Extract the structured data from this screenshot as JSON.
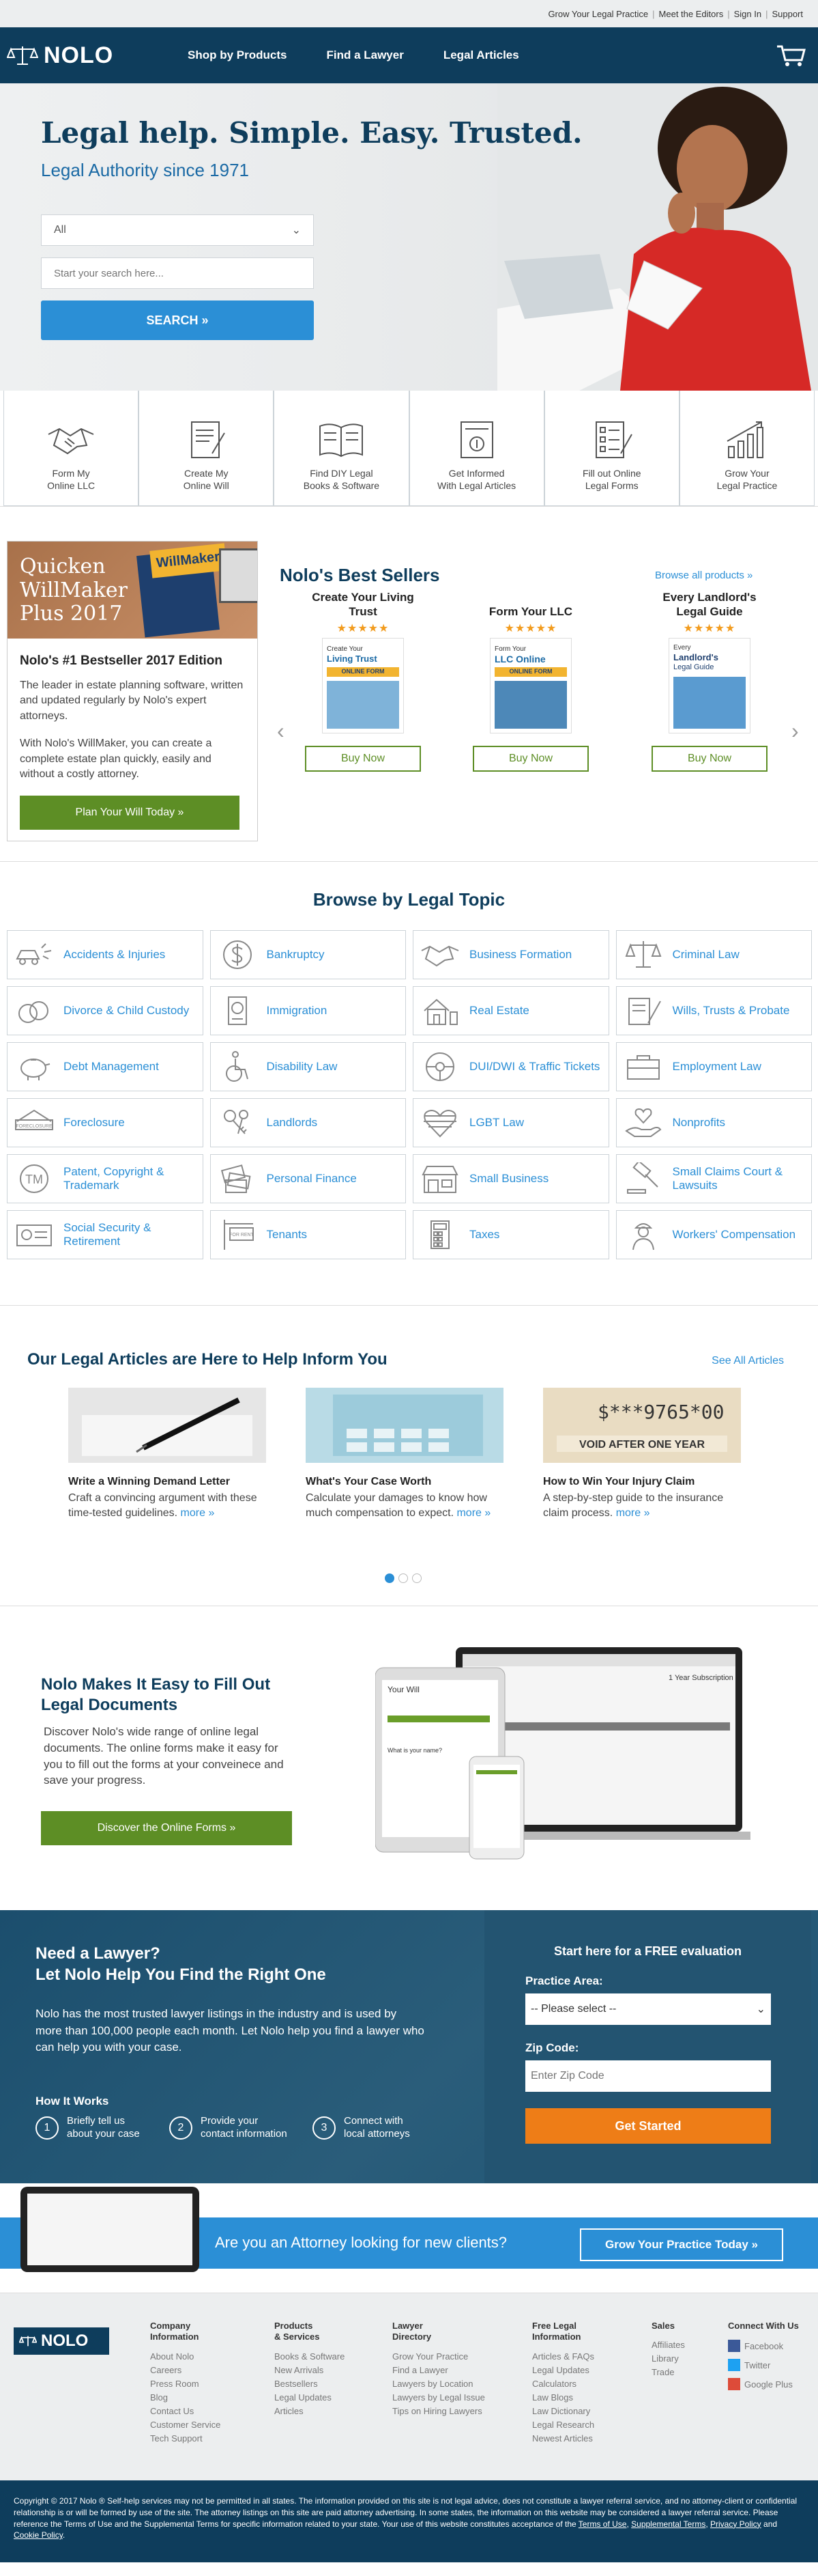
{
  "utility": {
    "links": [
      "Grow Your Legal Practice",
      "Meet the Editors",
      "Sign In",
      "Support"
    ]
  },
  "header": {
    "logo": "NOLO",
    "nav": [
      "Shop by Products",
      "Find a Lawyer",
      "Legal Articles"
    ]
  },
  "hero": {
    "title": "Legal help. Simple. Easy. Trusted.",
    "subtitle": "Legal Authority since 1971",
    "select_value": "All",
    "search_placeholder": "Start your search here...",
    "search_button": "SEARCH »"
  },
  "features": [
    {
      "icon": "handshake-icon",
      "l1": "Form My",
      "l2": "Online LLC"
    },
    {
      "icon": "will-document-icon",
      "l1": "Create My",
      "l2": "Online Will"
    },
    {
      "icon": "book-icon",
      "l1": "Find DIY Legal",
      "l2": "Books & Software"
    },
    {
      "icon": "article-icon",
      "l1": "Get Informed",
      "l2": "With Legal Articles"
    },
    {
      "icon": "checklist-icon",
      "l1": "Fill out Online",
      "l2": "Legal Forms"
    },
    {
      "icon": "growth-chart-icon",
      "l1": "Grow Your",
      "l2": "Legal Practice"
    }
  ],
  "promo": {
    "banner_l1": "Quicken",
    "banner_l2": "WillMaker",
    "banner_l3": "Plus 2017",
    "box_label": "WillMaker",
    "title": "Nolo's #1 Bestseller 2017 Edition",
    "p1": "The leader in estate planning software, written and updated regularly by Nolo's expert attorneys.",
    "p2": "With Nolo's WillMaker, you can create a complete estate plan quickly, easily and without a costly attorney.",
    "button": "Plan Your Will Today »"
  },
  "bestsellers": {
    "title": "Nolo's Best Sellers",
    "browse_all": "Browse all products »",
    "products": [
      {
        "name": "Create Your Living Trust",
        "cover_l1": "Create Your",
        "cover_l2": "Living Trust",
        "cover_tag": "ONLINE FORM",
        "buy": "Buy Now",
        "stars": "★★★★★"
      },
      {
        "name": "Form Your LLC",
        "cover_l1": "Form Your",
        "cover_l2": "LLC Online",
        "cover_tag": "ONLINE FORM",
        "buy": "Buy Now",
        "stars": "★★★★★"
      },
      {
        "name": "Every Landlord's Legal Guide",
        "cover_l1": "Every",
        "cover_l2": "Landlord's",
        "cover_l3": "Legal Guide",
        "buy": "Buy Now",
        "stars": "★★★★★"
      }
    ]
  },
  "topics": {
    "title": "Browse by Legal Topic",
    "items": [
      {
        "label": "Accidents & Injuries",
        "icon": "car-accident-icon"
      },
      {
        "label": "Bankruptcy",
        "icon": "dollar-circle-icon"
      },
      {
        "label": "Business Formation",
        "icon": "handshake-icon"
      },
      {
        "label": "Criminal Law",
        "icon": "scales-icon"
      },
      {
        "label": "Divorce & Child Custody",
        "icon": "rings-icon"
      },
      {
        "label": "Immigration",
        "icon": "passport-icon"
      },
      {
        "label": "Real Estate",
        "icon": "house-icon"
      },
      {
        "label": "Wills, Trusts & Probate",
        "icon": "quill-icon"
      },
      {
        "label": "Debt Management",
        "icon": "piggy-bank-icon"
      },
      {
        "label": "Disability Law",
        "icon": "wheelchair-icon"
      },
      {
        "label": "DUI/DWI & Traffic Tickets",
        "icon": "steering-wheel-icon"
      },
      {
        "label": "Employment Law",
        "icon": "briefcase-icon"
      },
      {
        "label": "Foreclosure",
        "icon": "foreclosure-sign-icon"
      },
      {
        "label": "Landlords",
        "icon": "keys-icon"
      },
      {
        "label": "LGBT Law",
        "icon": "heart-icon"
      },
      {
        "label": "Nonprofits",
        "icon": "hand-heart-icon"
      },
      {
        "label": "Patent, Copyright & Trademark",
        "icon": "trademark-icon"
      },
      {
        "label": "Personal Finance",
        "icon": "money-icon"
      },
      {
        "label": "Small Business",
        "icon": "storefront-icon"
      },
      {
        "label": "Small Claims Court & Lawsuits",
        "icon": "gavel-icon"
      },
      {
        "label": "Social Security & Retirement",
        "icon": "social-security-card-icon"
      },
      {
        "label": "Tenants",
        "icon": "for-rent-sign-icon"
      },
      {
        "label": "Taxes",
        "icon": "calculator-icon"
      },
      {
        "label": "Workers' Compensation",
        "icon": "worker-icon"
      }
    ],
    "for_rent": "FOR RENT",
    "foreclosure": "FORECLOSURE",
    "tm": "TM"
  },
  "articles": {
    "title": "Our Legal Articles are Here to Help Inform You",
    "see_all": "See All Articles",
    "items": [
      {
        "title": "Write a Winning Demand Letter",
        "desc": "Craft a convincing argument with these time-tested guidelines.",
        "more": "more »",
        "image": "pen-icon"
      },
      {
        "title": "What's Your Case Worth",
        "desc": "Calculate your damages to know how much compensation to expect.",
        "more": "more »",
        "image": "calculator-icon"
      },
      {
        "title": "How to Win Your Injury Claim",
        "desc": "A step-by-step guide to the insurance claim process.",
        "more": "more »",
        "image": "check-icon",
        "check_amount": "$***9765*00",
        "check_void": "VOID AFTER ONE YEAR"
      }
    ]
  },
  "forms_section": {
    "title_l1": "Nolo Makes It Easy to Fill Out",
    "title_l2": "Legal Documents",
    "text": "Discover Nolo's wide range of online legal documents. The online forms make it easy for you to fill out the forms at your conveinece and save your progress.",
    "button": "Discover the Online Forms »",
    "screen_title_1": "Your Will",
    "screen_title_2": "1 Year Subscription",
    "screen_q": "What is your name?"
  },
  "lawyer": {
    "title_l1": "Need a Lawyer?",
    "title_l2": "Let Nolo Help You Find the Right One",
    "text": "Nolo has the most trusted lawyer listings in  the industry and is used by more than 100,000 people each month. Let Nolo help you find a lawyer who can help you with your case.",
    "how": "How It Works",
    "steps": [
      {
        "n": "1",
        "l1": "Briefly tell us",
        "l2": "about your case"
      },
      {
        "n": "2",
        "l1": "Provide your",
        "l2": "contact information"
      },
      {
        "n": "3",
        "l1": "Connect with",
        "l2": "local attorneys"
      }
    ],
    "eval_title": "Start here for a FREE evaluation",
    "practice_label": "Practice Area:",
    "practice_value": "-- Please select --",
    "zip_label": "Zip Code:",
    "zip_placeholder": "Enter Zip Code",
    "button": "Get Started"
  },
  "attorney": {
    "question": "Are you an Attorney looking for new clients?",
    "button": "Grow Your Practice Today »"
  },
  "footer": {
    "logo": "NOLO",
    "cols": [
      {
        "h1": "Company",
        "h2": "Information",
        "links": [
          "About Nolo",
          "Careers",
          "Press Room",
          "Blog",
          "Contact Us",
          "Customer Service",
          "Tech Support"
        ]
      },
      {
        "h1": "Products",
        "h2": "& Services",
        "links": [
          "Books & Software",
          "New Arrivals",
          "Bestsellers",
          "Legal Updates",
          "Articles"
        ]
      },
      {
        "h1": "Lawyer",
        "h2": "Directory",
        "links": [
          "Grow Your Practice",
          "Find a Lawyer",
          "Lawyers by Location",
          "Lawyers by Legal Issue",
          "Tips on Hiring Lawyers"
        ]
      },
      {
        "h1": "Free Legal",
        "h2": "Information",
        "links": [
          "Articles & FAQs",
          "Legal Updates",
          "Calculators",
          "Law Blogs",
          "Law Dictionary",
          "Legal Research",
          "Newest Articles"
        ]
      },
      {
        "h1": "Sales",
        "h2": "",
        "links": [
          "Affiliates",
          "Library",
          "Trade"
        ]
      }
    ],
    "connect": "Connect With Us",
    "social": [
      "Facebook",
      "Twitter",
      "Google Plus"
    ]
  },
  "legal": {
    "text": "Copyright © 2017 Nolo ® Self-help services may not be permitted in all states. The information provided on this site is not legal advice, does not constitute a lawyer referral service, and no attorney-client or confidential relationship is or will be formed by use of the site. The attorney listings on this site are paid attorney advertising. In some states, the information on this website may be considered a lawyer referral service. Please reference the Terms of Use and the Supplemental Terms for specific information related to your state. Your use of this website constitutes acceptance of the",
    "terms": "Terms of Use",
    "supp": "Supplemental Terms",
    "privacy": "Privacy Policy",
    "cookie": "Cookie Policy",
    "and": "and"
  }
}
